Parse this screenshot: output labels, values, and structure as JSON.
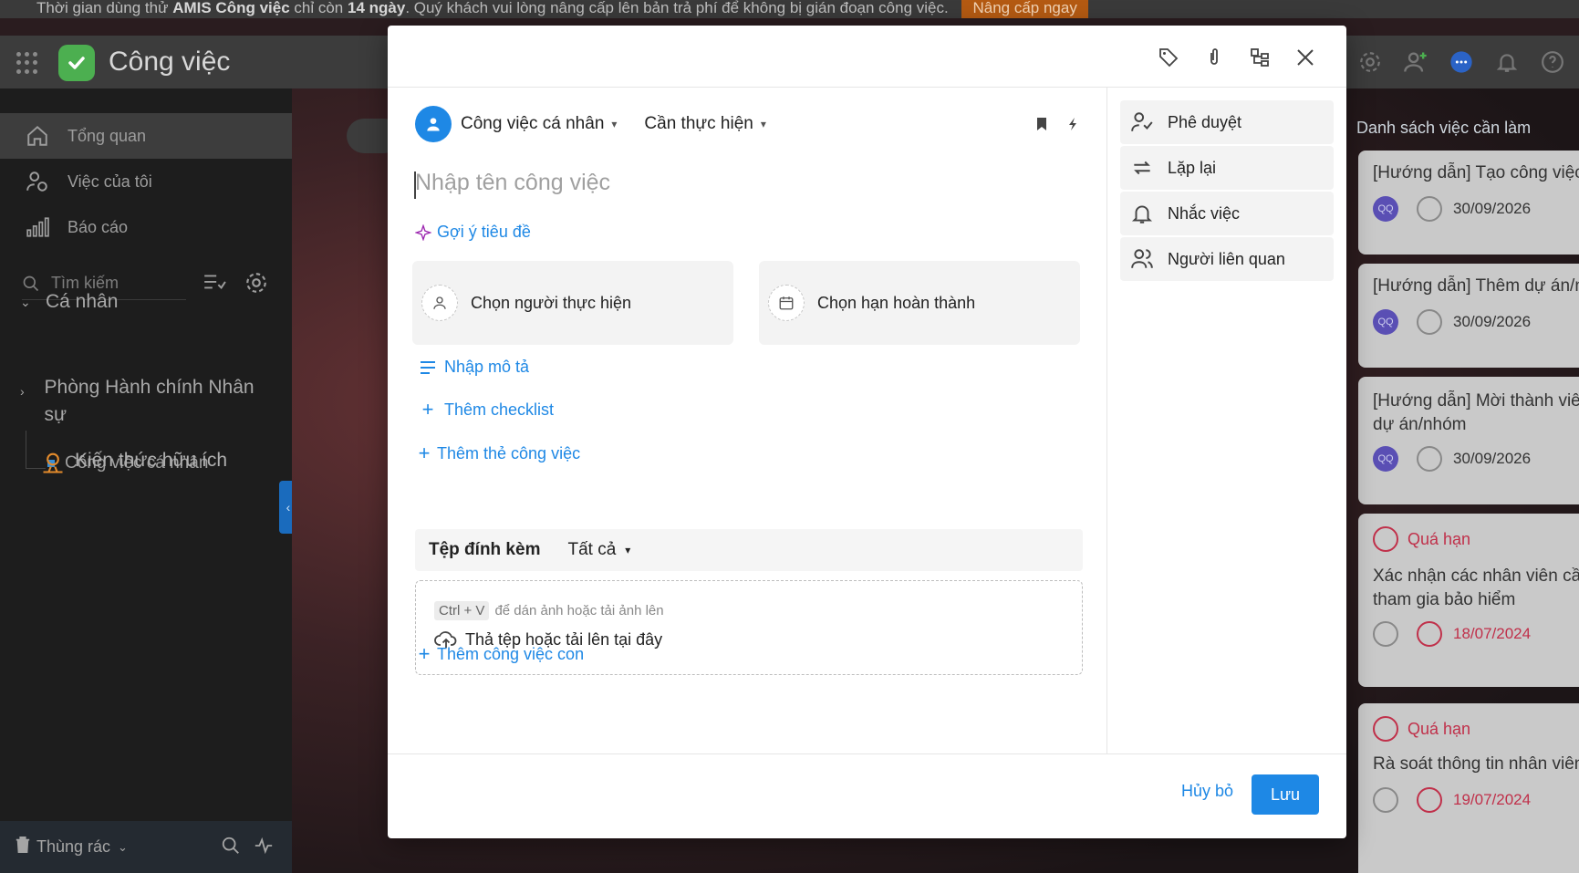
{
  "banner": {
    "prefix": "Thời gian dùng thử",
    "product": "AMIS Công việc",
    "mid": "chỉ còn",
    "days": "14 ngày",
    "suffix": ". Quý khách vui lòng nâng cấp lên bản trả phí để không bị gián đoạn công việc.",
    "upgrade_label": "Nâng cấp ngay"
  },
  "app": {
    "title": "Công việc"
  },
  "sidebar": {
    "items": [
      {
        "label": "Tổng quan",
        "icon": "home-icon"
      },
      {
        "label": "Việc của tôi",
        "icon": "user-check-icon"
      },
      {
        "label": "Báo cáo",
        "icon": "bar-chart-icon"
      }
    ],
    "search_placeholder": "Tìm kiếm",
    "group_personal": "Cá nhân",
    "personal_project": "Công việc cá nhân",
    "group_hr": "Phòng Hành chính Nhân sự",
    "knowledge": "Kiến thức hữu ích",
    "trash": "Thùng rác"
  },
  "tasklist": {
    "title": "Danh sách việc cần làm",
    "cards": [
      {
        "title": "[Hướng dẫn] Tạo công việc",
        "avatar": "QQ",
        "date": "30/09/2026"
      },
      {
        "title": "[Hướng dẫn] Thêm dự án/nhóm",
        "avatar": "QQ",
        "date": "30/09/2026"
      },
      {
        "title": "[Hướng dẫn] Mời thành viên dự án/nhóm",
        "avatar": "QQ",
        "date": "30/09/2026"
      },
      {
        "status": "Quá hạn",
        "title": "Xác nhận các nhân viên cần tham gia bảo hiểm",
        "date": "18/07/2024"
      },
      {
        "status": "Quá hạn",
        "title": "Rà soát thông tin nhân viên",
        "date": "19/07/2024"
      }
    ]
  },
  "modal": {
    "project_name": "Công việc cá nhân",
    "status": "Cần thực hiện",
    "task_name_placeholder": "Nhập tên công việc",
    "suggest_title": "Gợi ý tiêu đề",
    "assignee_placeholder": "Chọn người thực hiện",
    "due_placeholder": "Chọn hạn hoàn thành",
    "description_label": "Nhập mô tả",
    "checklist_label": "Thêm checklist",
    "tag_label": "Thêm thẻ công việc",
    "attachments_label": "Tệp đính kèm",
    "attachments_filter": "Tất cả",
    "paste_key": "Ctrl + V",
    "paste_hint": "để dán ảnh hoặc tải ảnh lên",
    "drop_hint": "Thả tệp hoặc tải lên tại đây",
    "subtask_label": "Thêm công việc con",
    "side": {
      "approve": "Phê duyệt",
      "repeat": "Lặp lại",
      "remind": "Nhắc việc",
      "related": "Người liên quan"
    },
    "cancel_label": "Hủy bỏ",
    "save_label": "Lưu"
  },
  "colors": {
    "accent": "#1e88e5",
    "overdue": "#c0304a",
    "brand_green": "#4caf50",
    "upgrade_orange": "#b45a12"
  }
}
